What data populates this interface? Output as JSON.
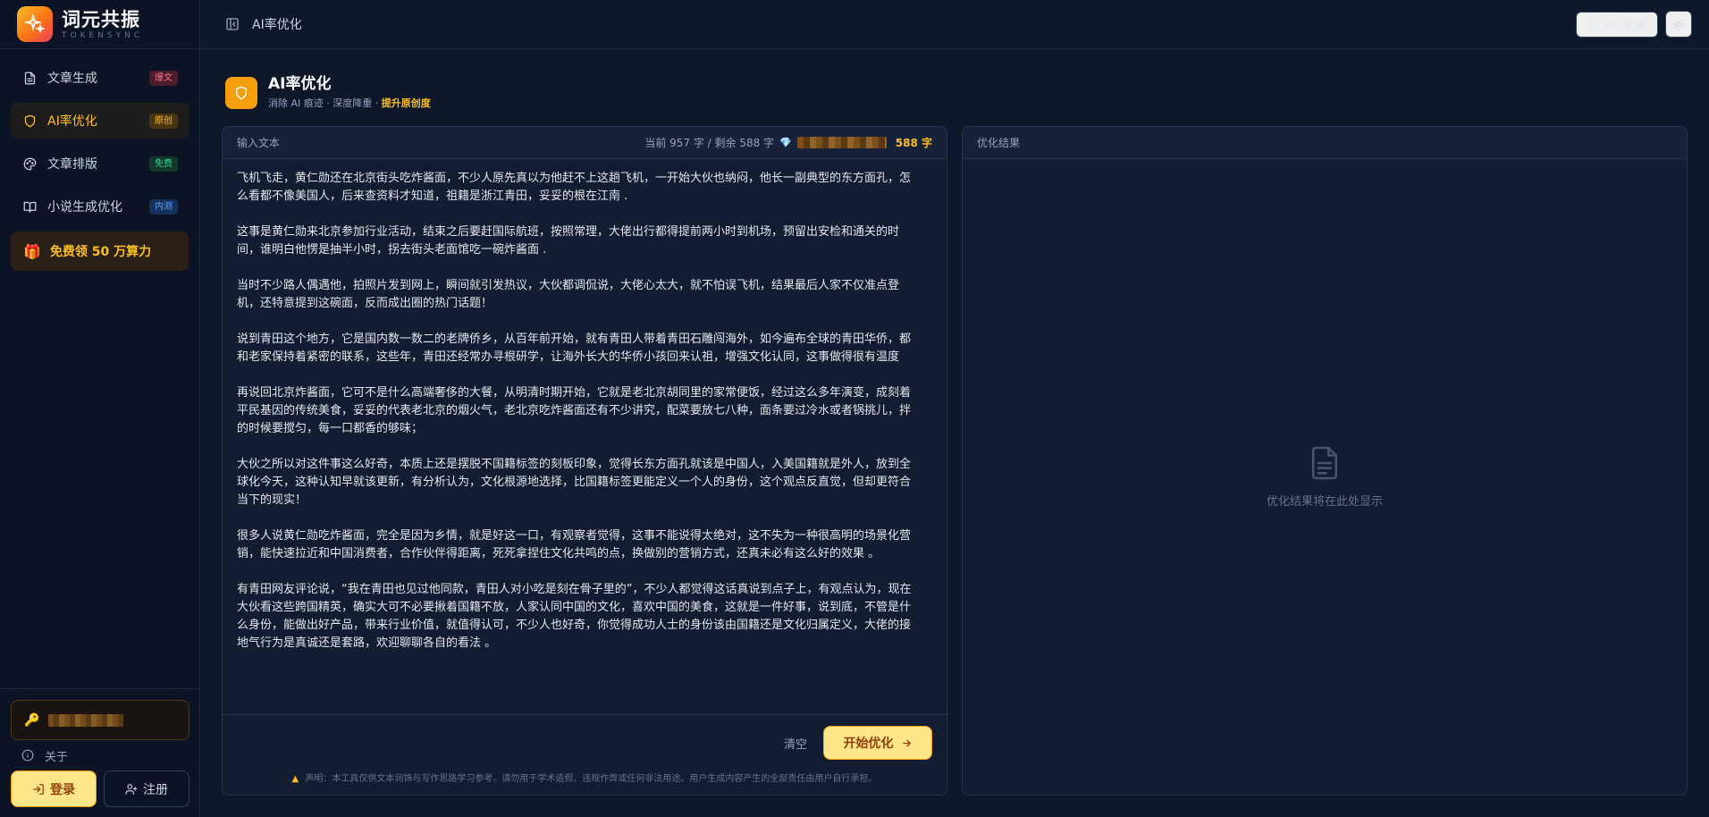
{
  "brand": {
    "name": "词元共振",
    "subtitle": "TOKENSYNC"
  },
  "sidebar": {
    "items": [
      {
        "label": "文章生成",
        "badge": "爆文"
      },
      {
        "label": "AI率优化",
        "badge": "原创"
      },
      {
        "label": "文章排版",
        "badge": "免费"
      },
      {
        "label": "小说生成优化",
        "badge": "内测"
      }
    ],
    "promo": "免费领 50 万算力",
    "about": "关于",
    "login": "登录",
    "register": "注册"
  },
  "topbar": {
    "title": "AI率优化",
    "api_button": "API 配置"
  },
  "page": {
    "title": "AI率优化",
    "subtitle_prefix": "消除 AI 痕迹 · 深度降重 ·",
    "subtitle_highlight": "提升原创度"
  },
  "input_panel": {
    "label": "输入文本",
    "stats": "当前 957 字 / 剩余 588 字",
    "remaining": "588 字",
    "paragraphs": [
      "飞机飞走，黄仁勋还在北京街头吃炸酱面，不少人原先真以为他赶不上这趟飞机，一开始大伙也纳闷，他长一副典型的东方面孔，怎么看都不像美国人，后来查资料才知道，祖籍是浙江青田，妥妥的根在江南 .",
      "这事是黄仁勋来北京参加行业活动，结束之后要赶国际航班，按照常理，大佬出行都得提前两小时到机场，预留出安检和通关的时间，谁明白他愣是抽半小时，拐去街头老面馆吃一碗炸酱面 .",
      "当时不少路人偶遇他，拍照片发到网上，瞬间就引发热议，大伙都调侃说，大佬心太大，就不怕误飞机，结果最后人家不仅准点登机，还特意提到这碗面，反而成出圈的热门话题！",
      "说到青田这个地方，它是国内数一数二的老牌侨乡，从百年前开始，就有青田人带着青田石雕闯海外，如今遍布全球的青田华侨，都和老家保持着紧密的联系，这些年，青田还经常办寻根研学，让海外长大的华侨小孩回来认祖，增强文化认同，这事做得很有温度",
      "再说回北京炸酱面，它可不是什么高端奢侈的大餐，从明清时期开始，它就是老北京胡同里的家常便饭，经过这么多年演变，成刻着平民基因的传统美食，妥妥的代表老北京的烟火气，老北京吃炸酱面还有不少讲究，配菜要放七八种，面条要过冷水或者锅挑儿，拌的时候要搅匀，每一口都香的够味；",
      "大伙之所以对这件事这么好奇，本质上还是摆脱不国籍标签的刻板印象，觉得长东方面孔就该是中国人，入美国籍就是外人，放到全球化今天，这种认知早就该更新，有分析认为，文化根源地选择，比国籍标签更能定义一个人的身份，这个观点反直觉，但却更符合当下的现实！",
      "很多人说黄仁勋吃炸酱面，完全是因为乡情，就是好这一口，有观察者觉得，这事不能说得太绝对，这不失为一种很高明的场景化营销，能快速拉近和中国消费者，合作伙伴得距离，死死拿捏住文化共鸣的点，换做别的营销方式，还真未必有这么好的效果 。",
      "有青田网友评论说，“我在青田也见过他同款，青田人对小吃是刻在骨子里的”，不少人都觉得这话真说到点子上，有观点认为，现在大伙看这些跨国精英，确实大可不必要揪着国籍不放，人家认同中国的文化，喜欢中国的美食，这就是一件好事，说到底，不管是什么身份，能做出好产品，带来行业价值，就值得认可，不少人也好奇，你觉得成功人士的身份该由国籍还是文化归属定义，大佬的接地气行为是真诚还是套路，欢迎聊聊各自的看法 。"
    ],
    "clear_button": "清空",
    "start_button": "开始优化",
    "disclaimer": "声明：本工具仅供文本润饰与写作思路学习参考。请勿用于学术造假、违规作弊或任何非法用途。用户生成内容产生的全部责任由用户自行承担。"
  },
  "result_panel": {
    "label": "优化结果",
    "empty_text": "优化结果将在此处显示"
  }
}
